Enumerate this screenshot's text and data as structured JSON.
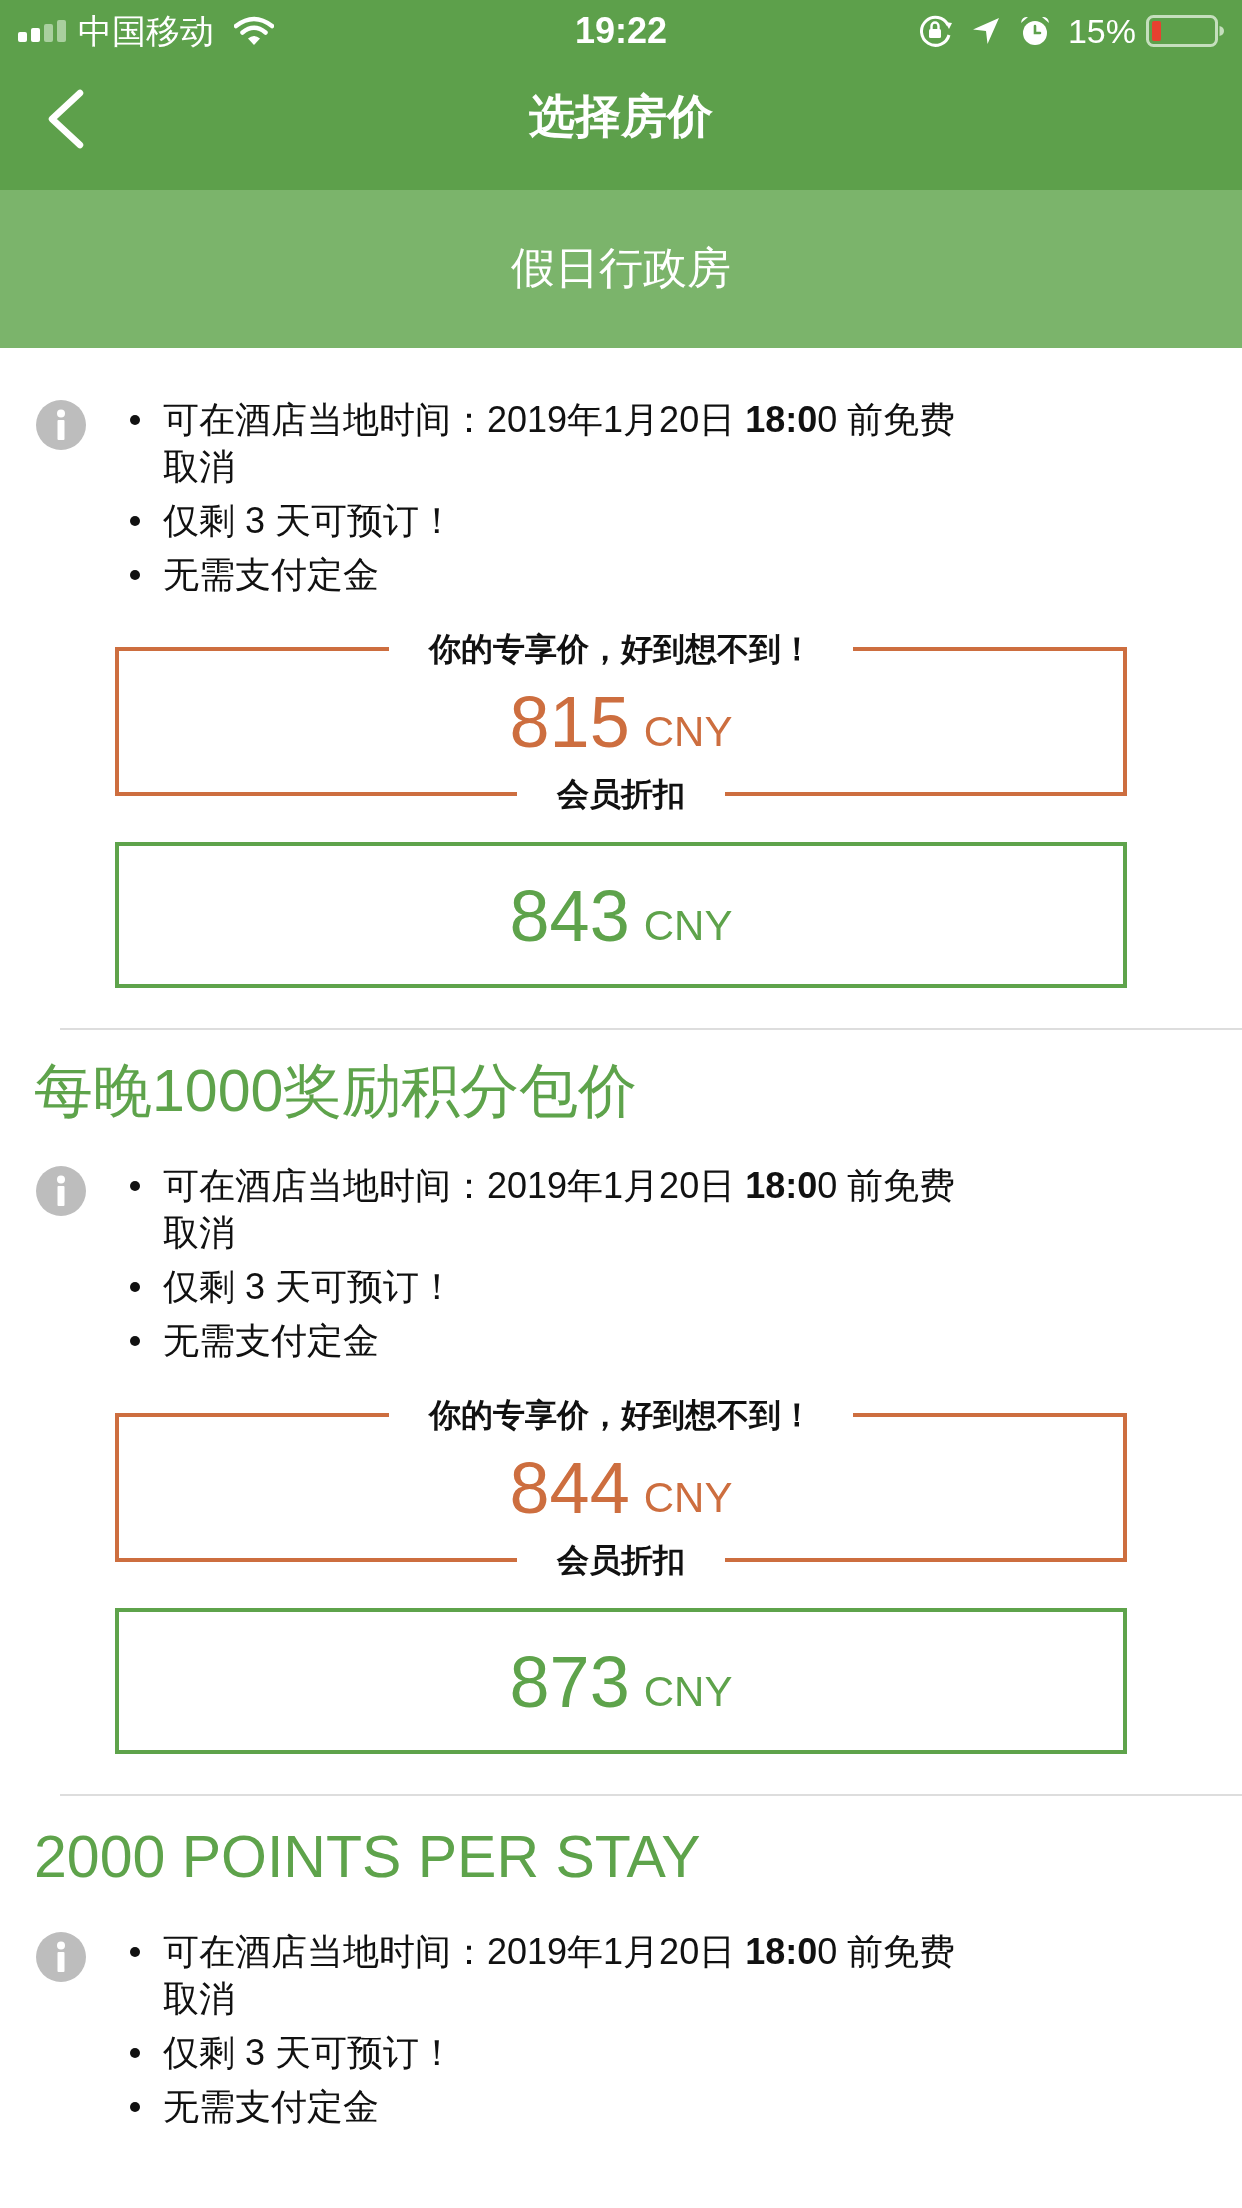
{
  "status_bar": {
    "carrier": "中国移动",
    "time": "19:22",
    "battery": "15%"
  },
  "nav": {
    "title": "选择房价"
  },
  "room": {
    "name": "假日行政房"
  },
  "rates": [
    {
      "conditions": [
        "可在酒店当地时间：2019年1月20日 **18:0**0 前免费取消",
        "仅剩 3 天可预订！",
        "无需支付定金"
      ],
      "member_offer": {
        "caption": "你的专享价，好到想不到！",
        "price": "815",
        "currency": "CNY",
        "label": "会员折扣"
      },
      "standard_price": {
        "price": "843",
        "currency": "CNY"
      }
    },
    {
      "title": "每晚1000奖励积分包价",
      "conditions": [
        "可在酒店当地时间：2019年1月20日 **18:0**0 前免费取消",
        "仅剩 3 天可预订！",
        "无需支付定金"
      ],
      "member_offer": {
        "caption": "你的专享价，好到想不到！",
        "price": "844",
        "currency": "CNY",
        "label": "会员折扣"
      },
      "standard_price": {
        "price": "873",
        "currency": "CNY"
      }
    },
    {
      "title": "2000 POINTS PER STAY",
      "conditions": [
        "可在酒店当地时间：2019年1月20日 **18:0**0 前免费取消",
        "仅剩 3 天可预订！",
        "无需支付定金"
      ]
    }
  ]
}
